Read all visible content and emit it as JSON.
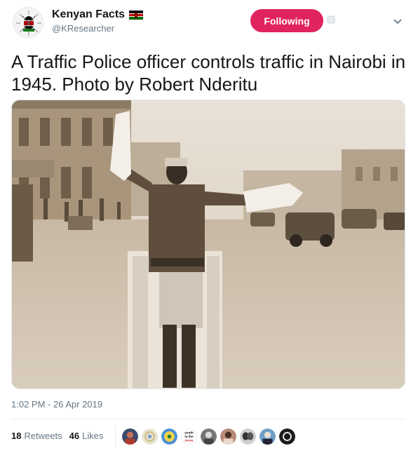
{
  "user": {
    "display_name": "Kenyan Facts",
    "handle": "@KResearcher",
    "avatar_icon": "kenya-coat-of-arms-icon",
    "flag_icon": "kenya-flag-icon"
  },
  "follow_button": {
    "label": "Following",
    "color": "#e0245e"
  },
  "tweet": {
    "text": "A Traffic Police officer controls traffic in Nairobi in 1945. Photo by Robert Nderitu",
    "timestamp": "1:02 PM - 26 Apr 2019"
  },
  "photo": {
    "alt_icon": "sepia-photo-traffic-officer"
  },
  "stats": {
    "retweets_count": "18",
    "retweets_label": "Retweets",
    "likes_count": "46",
    "likes_label": "Likes"
  },
  "liker_avatars": [
    "liker-avatar-1",
    "liker-avatar-2",
    "liker-avatar-3",
    "liker-avatar-4",
    "liker-avatar-5",
    "liker-avatar-6",
    "liker-avatar-7",
    "liker-avatar-8",
    "liker-avatar-9"
  ],
  "liker_text_avatar": {
    "line1": "youth",
    "line2": "in the",
    "line3": "move"
  }
}
